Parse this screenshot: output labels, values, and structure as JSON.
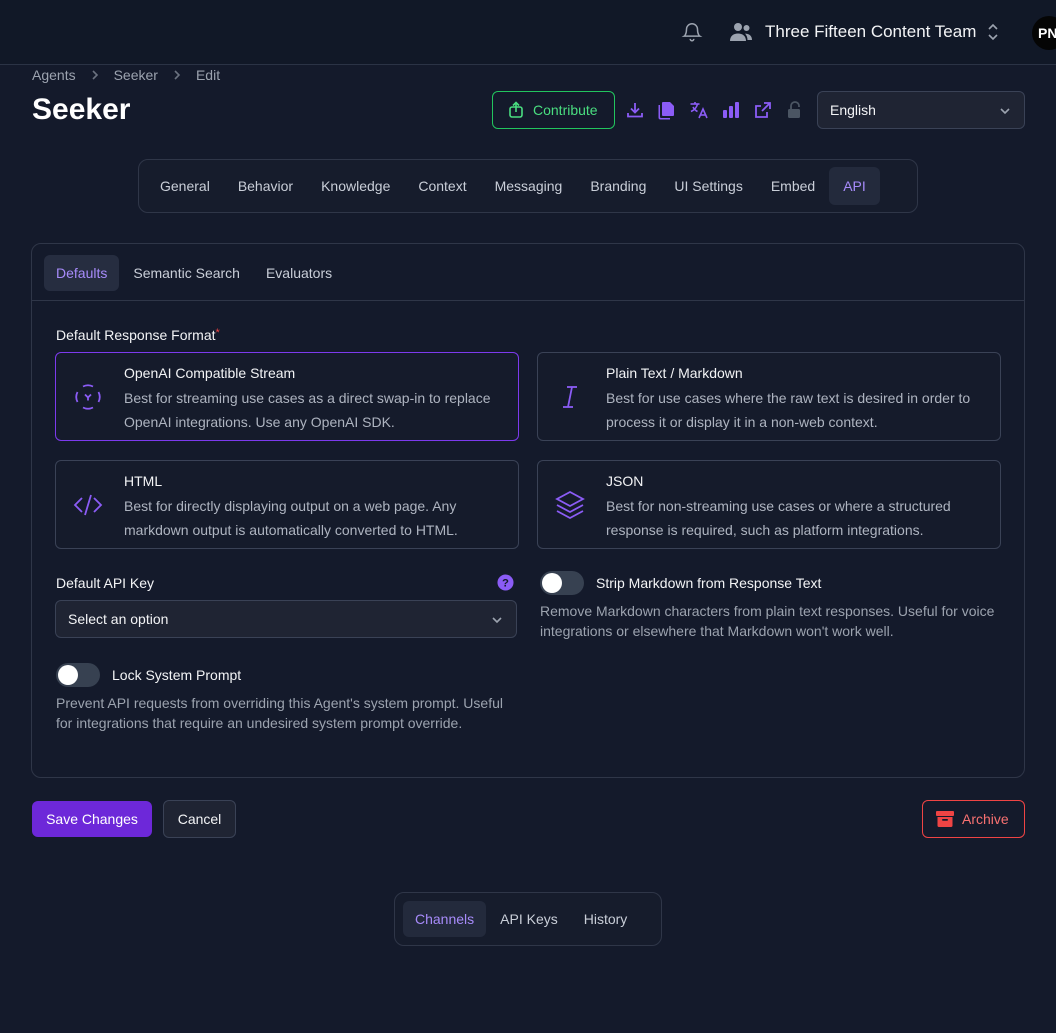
{
  "header": {
    "team_name": "Three Fifteen Content Team",
    "avatar_initials": "PN"
  },
  "breadcrumb": [
    "Agents",
    "Seeker",
    "Edit"
  ],
  "page": {
    "title": "Seeker",
    "contribute_label": "Contribute",
    "language": "English"
  },
  "toolbar_icons": [
    "download-icon",
    "copy-icon",
    "translate-icon",
    "analytics-icon",
    "external-link-icon",
    "unlock-icon"
  ],
  "main_tabs": [
    "General",
    "Behavior",
    "Knowledge",
    "Context",
    "Messaging",
    "Branding",
    "UI Settings",
    "Embed",
    "API"
  ],
  "main_tabs_active": "API",
  "sub_tabs": [
    "Defaults",
    "Semantic Search",
    "Evaluators"
  ],
  "sub_tabs_active": "Defaults",
  "response_format": {
    "label": "Default Response Format",
    "required_mark": "*",
    "options": [
      {
        "title": "OpenAI Compatible Stream",
        "desc": "Best for streaming use cases as a direct swap-in to replace OpenAI integrations. Use any OpenAI SDK.",
        "icon": "openai-stream-icon",
        "selected": true
      },
      {
        "title": "Plain Text / Markdown",
        "desc": "Best for use cases where the raw text is desired in order to process it or display it in a non-web context.",
        "icon": "text-cursor-icon",
        "selected": false
      },
      {
        "title": "HTML",
        "desc": "Best for directly displaying output on a web page. Any markdown output is automatically converted to HTML.",
        "icon": "code-icon",
        "selected": false
      },
      {
        "title": "JSON",
        "desc": "Best for non-streaming use cases or where a structured response is required, such as platform integrations.",
        "icon": "layers-icon",
        "selected": false
      }
    ]
  },
  "api_key": {
    "label": "Default API Key",
    "placeholder": "Select an option"
  },
  "strip_markdown": {
    "label": "Strip Markdown from Response Text",
    "help": "Remove Markdown characters from plain text responses. Useful for voice integrations or elsewhere that Markdown won't work well.",
    "enabled": false
  },
  "lock_prompt": {
    "label": "Lock System Prompt",
    "help": "Prevent API requests from overriding this Agent's system prompt. Useful for integrations that require an undesired system prompt override.",
    "enabled": false
  },
  "actions": {
    "save": "Save Changes",
    "cancel": "Cancel",
    "archive": "Archive"
  },
  "bottom_tabs": [
    "Channels",
    "API Keys",
    "History"
  ],
  "bottom_tabs_active": "Channels",
  "colors": {
    "accent": "#7c3aed",
    "success": "#22c55e",
    "danger": "#ef4444",
    "background": "#141a2b"
  }
}
